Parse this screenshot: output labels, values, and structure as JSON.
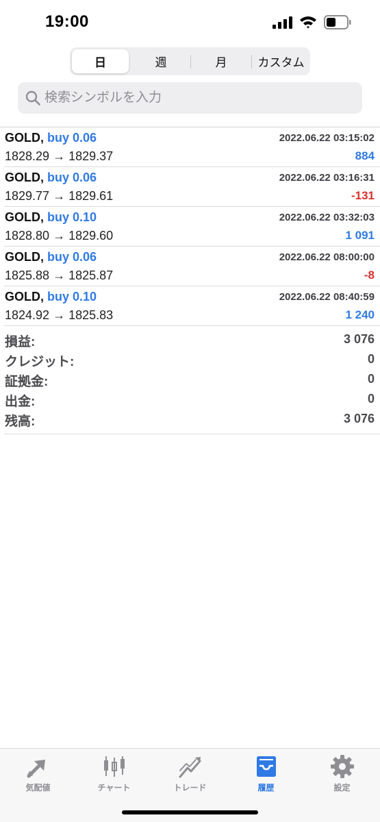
{
  "status_bar": {
    "time": "19:00"
  },
  "segments": [
    {
      "label": "日",
      "active": true
    },
    {
      "label": "週",
      "active": false
    },
    {
      "label": "月",
      "active": false
    },
    {
      "label": "カスタム",
      "active": false
    }
  ],
  "search": {
    "placeholder": "検索シンボルを入力"
  },
  "deals": [
    {
      "symbol": "GOLD,",
      "side": "buy 0.06",
      "prices": "1828.29 → 1829.37",
      "time": "2022.06.22 03:15:02",
      "profit": "884"
    },
    {
      "symbol": "GOLD,",
      "side": "buy 0.06",
      "prices": "1829.77 → 1829.61",
      "time": "2022.06.22 03:16:31",
      "profit": "-131"
    },
    {
      "symbol": "GOLD,",
      "side": "buy 0.10",
      "prices": "1828.80 → 1829.60",
      "time": "2022.06.22 03:32:03",
      "profit": "1 091"
    },
    {
      "symbol": "GOLD,",
      "side": "buy 0.06",
      "prices": "1825.88 → 1825.87",
      "time": "2022.06.22 08:00:00",
      "profit": "-8"
    },
    {
      "symbol": "GOLD,",
      "side": "buy 0.10",
      "prices": "1824.92 → 1825.83",
      "time": "2022.06.22 08:40:59",
      "profit": "1 240"
    }
  ],
  "summary": {
    "profit_label": "損益:",
    "profit_value": "3 076",
    "credit_label": "クレジット:",
    "credit_value": "0",
    "deposit_label": "証拠金:",
    "deposit_value": "0",
    "withdrawal_label": "出金:",
    "withdrawal_value": "0",
    "balance_label": "残高:",
    "balance_value": "3 076"
  },
  "tabbar": [
    {
      "label": "気配値",
      "icon": "quotes-arrows-icon",
      "active": false
    },
    {
      "label": "チャート",
      "icon": "candlestick-chart-icon",
      "active": false
    },
    {
      "label": "トレード",
      "icon": "trade-trend-icon",
      "active": false
    },
    {
      "label": "履歴",
      "icon": "history-inbox-icon",
      "active": true
    },
    {
      "label": "設定",
      "icon": "gear-icon",
      "active": false
    }
  ],
  "colors": {
    "accent": "#2f7ae5",
    "negative": "#d8302c",
    "inactive": "#8e8e93"
  }
}
